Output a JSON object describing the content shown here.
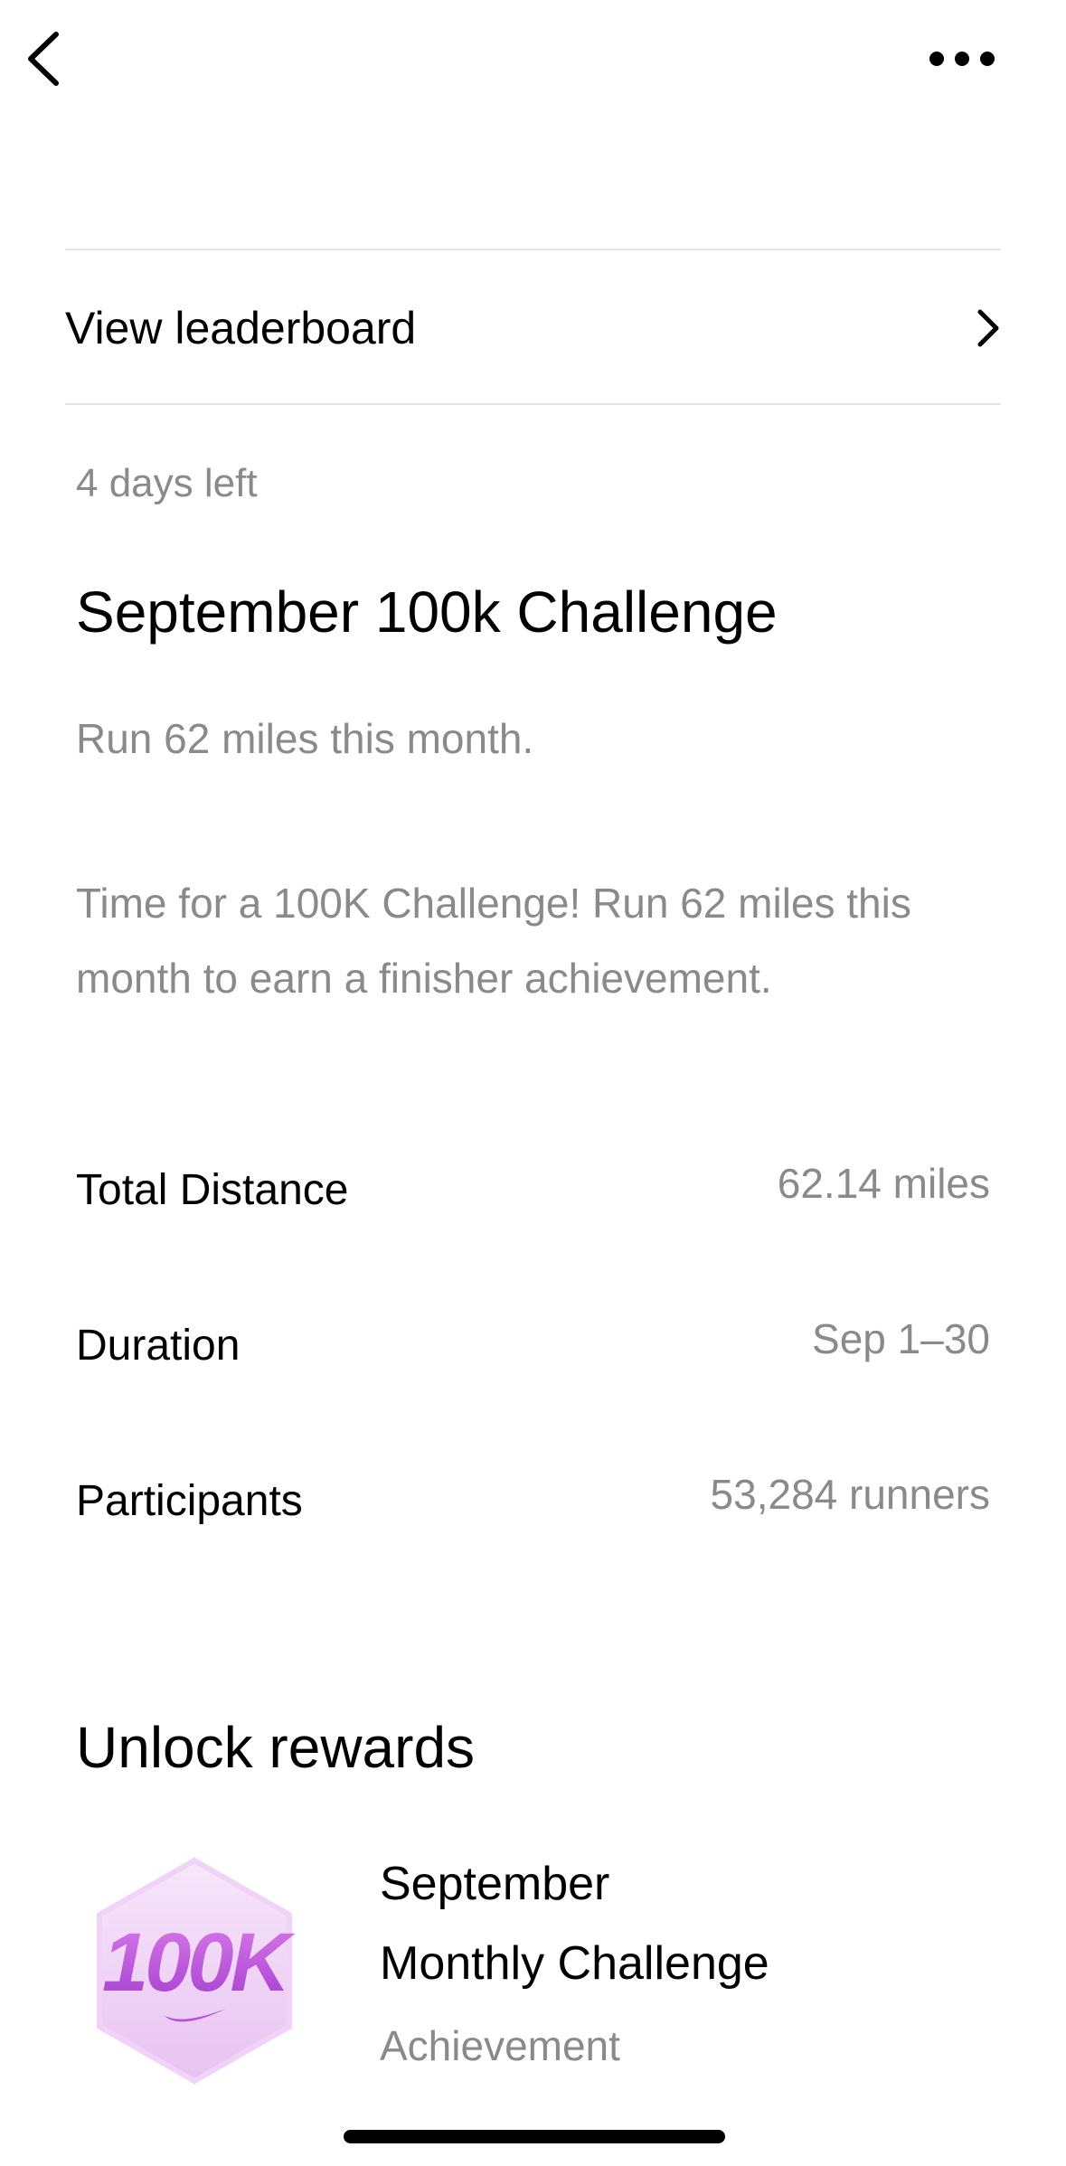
{
  "nav": {
    "back_icon": "chevron-left-icon",
    "more_icon": "ellipsis-icon"
  },
  "leaderboard": {
    "label": "View leaderboard",
    "icon": "chevron-right-icon"
  },
  "challenge": {
    "days_left": "4 days left",
    "title": "September 100k Challenge",
    "subtitle": "Run 62 miles this month.",
    "description": "Time for a 100K Challenge! Run 62 miles this month to earn a finisher achievement."
  },
  "stats": [
    {
      "label": "Total Distance",
      "value": "62.14 miles"
    },
    {
      "label": "Duration",
      "value": "Sep 1–30"
    },
    {
      "label": "Participants",
      "value": "53,284 runners"
    }
  ],
  "rewards": {
    "heading": "Unlock rewards",
    "badge_text": "100K",
    "badge_icon": "100k-badge-icon",
    "item_title_line1": "September",
    "item_title_line2": "Monthly Challenge",
    "item_type": "Achievement"
  },
  "colors": {
    "secondary_text": "#8a8a8a",
    "badge_purple": "#b84fd8",
    "badge_light": "#f2d9f7"
  }
}
